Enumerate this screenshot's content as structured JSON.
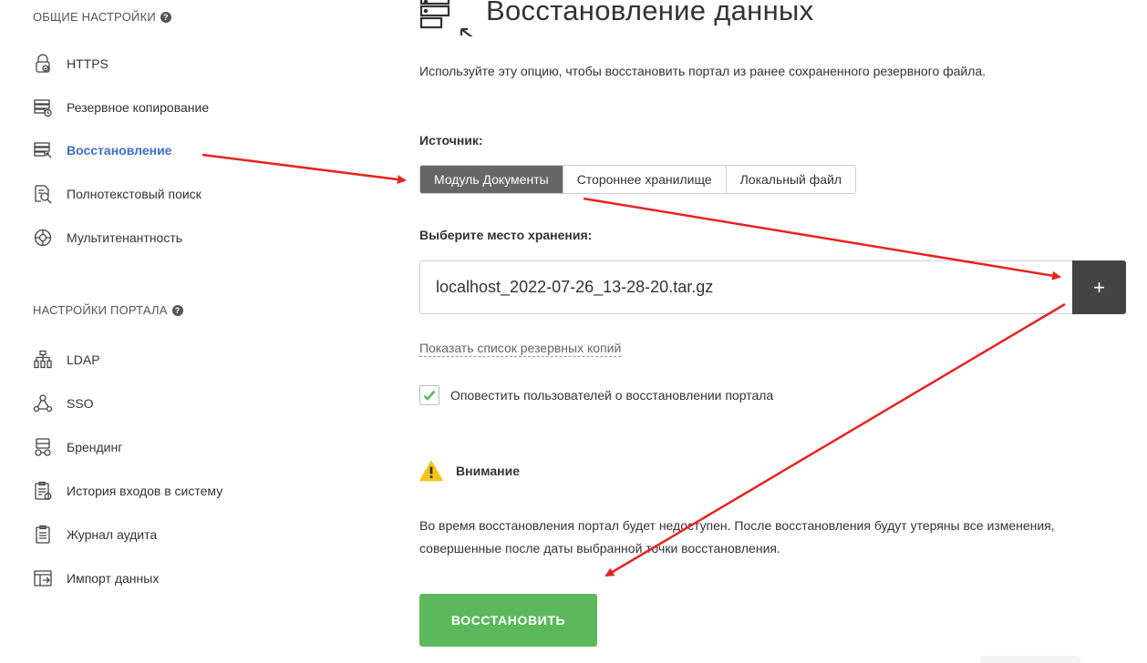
{
  "sidebar": {
    "general_title": "ОБЩИЕ НАСТРОЙКИ",
    "portal_title": "НАСТРОЙКИ ПОРТАЛА",
    "general_items": [
      {
        "label": "HTTPS",
        "icon": "https-lock-icon"
      },
      {
        "label": "Резервное копирование",
        "icon": "backup-icon"
      },
      {
        "label": "Восстановление",
        "icon": "restore-icon"
      },
      {
        "label": "Полнотекстовый поиск",
        "icon": "fulltext-search-icon"
      },
      {
        "label": "Мультитенантность",
        "icon": "multitenancy-icon"
      }
    ],
    "portal_items": [
      {
        "label": "LDAP",
        "icon": "ldap-icon"
      },
      {
        "label": "SSO",
        "icon": "sso-icon"
      },
      {
        "label": "Брендинг",
        "icon": "branding-icon"
      },
      {
        "label": "История входов в систему",
        "icon": "login-history-icon"
      },
      {
        "label": "Журнал аудита",
        "icon": "audit-log-icon"
      },
      {
        "label": "Импорт данных",
        "icon": "data-import-icon"
      }
    ],
    "active_item": "Восстановление"
  },
  "main": {
    "title": "Восстановление данных",
    "description": "Используйте эту опцию, чтобы восстановить портал из ранее сохраненного резервного файла.",
    "source_label": "Источник:",
    "source_options": [
      "Модуль Документы",
      "Стороннее хранилище",
      "Локальный файл"
    ],
    "source_selected": "Модуль Документы",
    "storage_label": "Выберите место хранения:",
    "storage_value": "localhost_2022-07-26_13-28-20.tar.gz",
    "add_button": "+",
    "backup_list_link": "Показать список резервных копий",
    "notify_label": "Оповестить пользователей о восстановлении портала",
    "notify_checked": true,
    "warning_title": "Внимание",
    "warning_text": "Во время восстановления портал будет недоступен. После восстановления будут утеряны все изменения, совершенные после даты выбранной точки восстановления.",
    "restore_button": "ВОССТАНОВИТЬ"
  },
  "colors": {
    "accent": "#3d6fc4",
    "selected_segment": "#666666",
    "plus_button": "#444444",
    "restore_button": "#5cb85c",
    "checkmark": "#5cb85c",
    "warning": "#f5c518",
    "annotation_arrow": "#e8231f"
  }
}
